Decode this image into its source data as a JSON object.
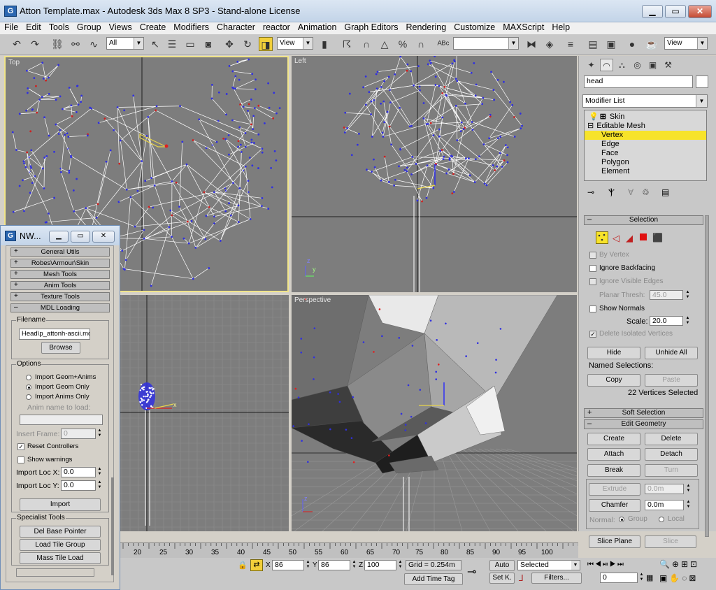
{
  "window": {
    "title": "Atton Template.max - Autodesk 3ds Max 8 SP3  - Stand-alone License",
    "icon": "3ds-max-app-icon",
    "minimize_glyph": "▁",
    "maximize_glyph": "▭",
    "close_glyph": "✕"
  },
  "menu": [
    "File",
    "Edit",
    "Tools",
    "Group",
    "Views",
    "Create",
    "Modifiers",
    "Character",
    "reactor",
    "Animation",
    "Graph Editors",
    "Rendering",
    "Customize",
    "MAXScript",
    "Help"
  ],
  "toolbar": {
    "selection_filter": "All",
    "ref_coord": "View",
    "named_selection": "",
    "view_dropdown": "View"
  },
  "viewports": {
    "top": "Top",
    "left": "Left",
    "perspective": "Perspective"
  },
  "axis": {
    "x": "x",
    "y": "y",
    "z": "z"
  },
  "command_panel": {
    "object_name": "head",
    "modifier_list": "Modifier List",
    "stack": [
      "Skin",
      "Editable Mesh",
      "Vertex",
      "Edge",
      "Face",
      "Polygon",
      "Element"
    ],
    "selection": {
      "title": "Selection",
      "by_vertex": "By Vertex",
      "ignore_backfacing": "Ignore Backfacing",
      "ignore_visible_edges": "Ignore Visible Edges",
      "planar_thresh_label": "Planar Thresh:",
      "planar_thresh_value": "45.0",
      "show_normals": "Show Normals",
      "scale_label": "Scale:",
      "scale_value": "20.0",
      "delete_isolated": "Delete Isolated Vertices",
      "hide": "Hide",
      "unhide_all": "Unhide All",
      "named_selections": "Named Selections:",
      "copy": "Copy",
      "paste": "Paste",
      "selected_count": "22 Vertices Selected"
    },
    "soft_selection": "Soft Selection",
    "edit_geometry": {
      "title": "Edit Geometry",
      "create": "Create",
      "delete": "Delete",
      "attach": "Attach",
      "detach": "Detach",
      "break": "Break",
      "turn": "Turn",
      "extrude": "Extrude",
      "extrude_value": "0.0m",
      "chamfer": "Chamfer",
      "chamfer_value": "0.0m",
      "normal_label": "Normal:",
      "group": "Group",
      "local": "Local",
      "slice_plane": "Slice Plane",
      "slice": "Slice"
    }
  },
  "nw_panel": {
    "title": "NW...",
    "rollouts": [
      "General Utils",
      "Robes\\Armour\\Skin",
      "Mesh Tools",
      "Anim Tools",
      "Texture Tools",
      "MDL Loading"
    ],
    "filename_group": "Filename",
    "filename_value": "Head\\p_attonh-ascii.mdl",
    "browse": "Browse",
    "options_group": "Options",
    "import_geom_anims": "Import Geom+Anims",
    "import_geom_only": "Import Geom Only",
    "import_anims_only": "Import Anims Only",
    "anim_name_label": "Anim name to load:",
    "insert_frame_label": "Insert Frame:",
    "insert_frame_value": "0",
    "reset_controllers": "Reset Controllers",
    "show_warnings": "Show warnings",
    "import_loc_x_label": "Import Loc X:",
    "import_loc_x_value": "0.0",
    "import_loc_y_label": "Import Loc Y:",
    "import_loc_y_value": "0.0",
    "import": "Import",
    "specialist_group": "Specialist Tools",
    "del_base_pointer": "Del Base Pointer",
    "load_tile_group": "Load Tile Group",
    "mass_tile_load": "Mass Tile Load"
  },
  "timeline": {
    "ticks": [
      "20",
      "25",
      "30",
      "35",
      "40",
      "45",
      "50",
      "55",
      "60",
      "65",
      "70",
      "75",
      "80",
      "85",
      "90",
      "95",
      "100"
    ]
  },
  "status": {
    "x_label": "X",
    "x_value": "86",
    "y_label": "Y",
    "y_value": "86",
    "z_label": "Z",
    "z_value": "100",
    "grid": "Grid = 0.254m",
    "add_time_tag": "Add Time Tag",
    "auto": "Auto",
    "set_key": "Set K.",
    "key_mode": "Selected",
    "filters": "Filters...",
    "frame": "0"
  }
}
